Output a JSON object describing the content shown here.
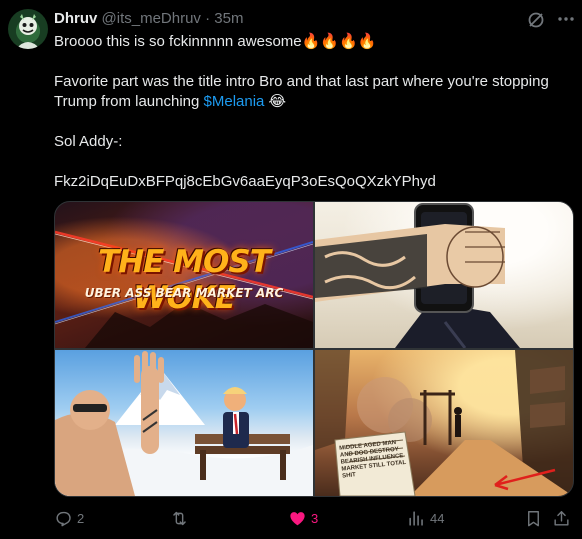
{
  "author": {
    "name": "Dhruv",
    "handle": "@its_meDhruv",
    "separator": "·",
    "time": "35m"
  },
  "tweet": {
    "line1": "Broooo this is so fckinnnnn awesome🔥🔥🔥🔥",
    "line2": "Favorite part was the title intro Bro and that last part where you're stopping",
    "line3_prefix": "Trump from launching ",
    "cashtag": "$Melania",
    "line3_suffix": " 😂",
    "line4": "Sol Addy-:",
    "line5": "Fkz2iDqEuDxBFPqj8cEbGv6aaEyqP3oEsQoQXzkYPhyd"
  },
  "media": {
    "tile1_title": "THE MOST WOKE",
    "tile1_subtitle": "UBER ASS BEAR MARKET ARC",
    "tile4_newspaper": "MIDDLE AGED MAN AND DOG DESTROY BEARISH INFLUENCE MARKET STILL TOTAL SHIT"
  },
  "actions": {
    "replies": "2",
    "reposts": "",
    "likes": "3",
    "views": "44"
  },
  "icons": {
    "reply": "reply-icon",
    "repost": "repost-icon",
    "like": "heart-filled-icon",
    "views": "views-icon",
    "bookmark": "bookmark-icon",
    "share": "share-icon",
    "grok": "grok-icon",
    "more": "more-icon"
  },
  "colors": {
    "background": "#000000",
    "text": "#e7e9ea",
    "secondary": "#71767b",
    "link": "#1d9bf0",
    "like": "#f91880"
  }
}
